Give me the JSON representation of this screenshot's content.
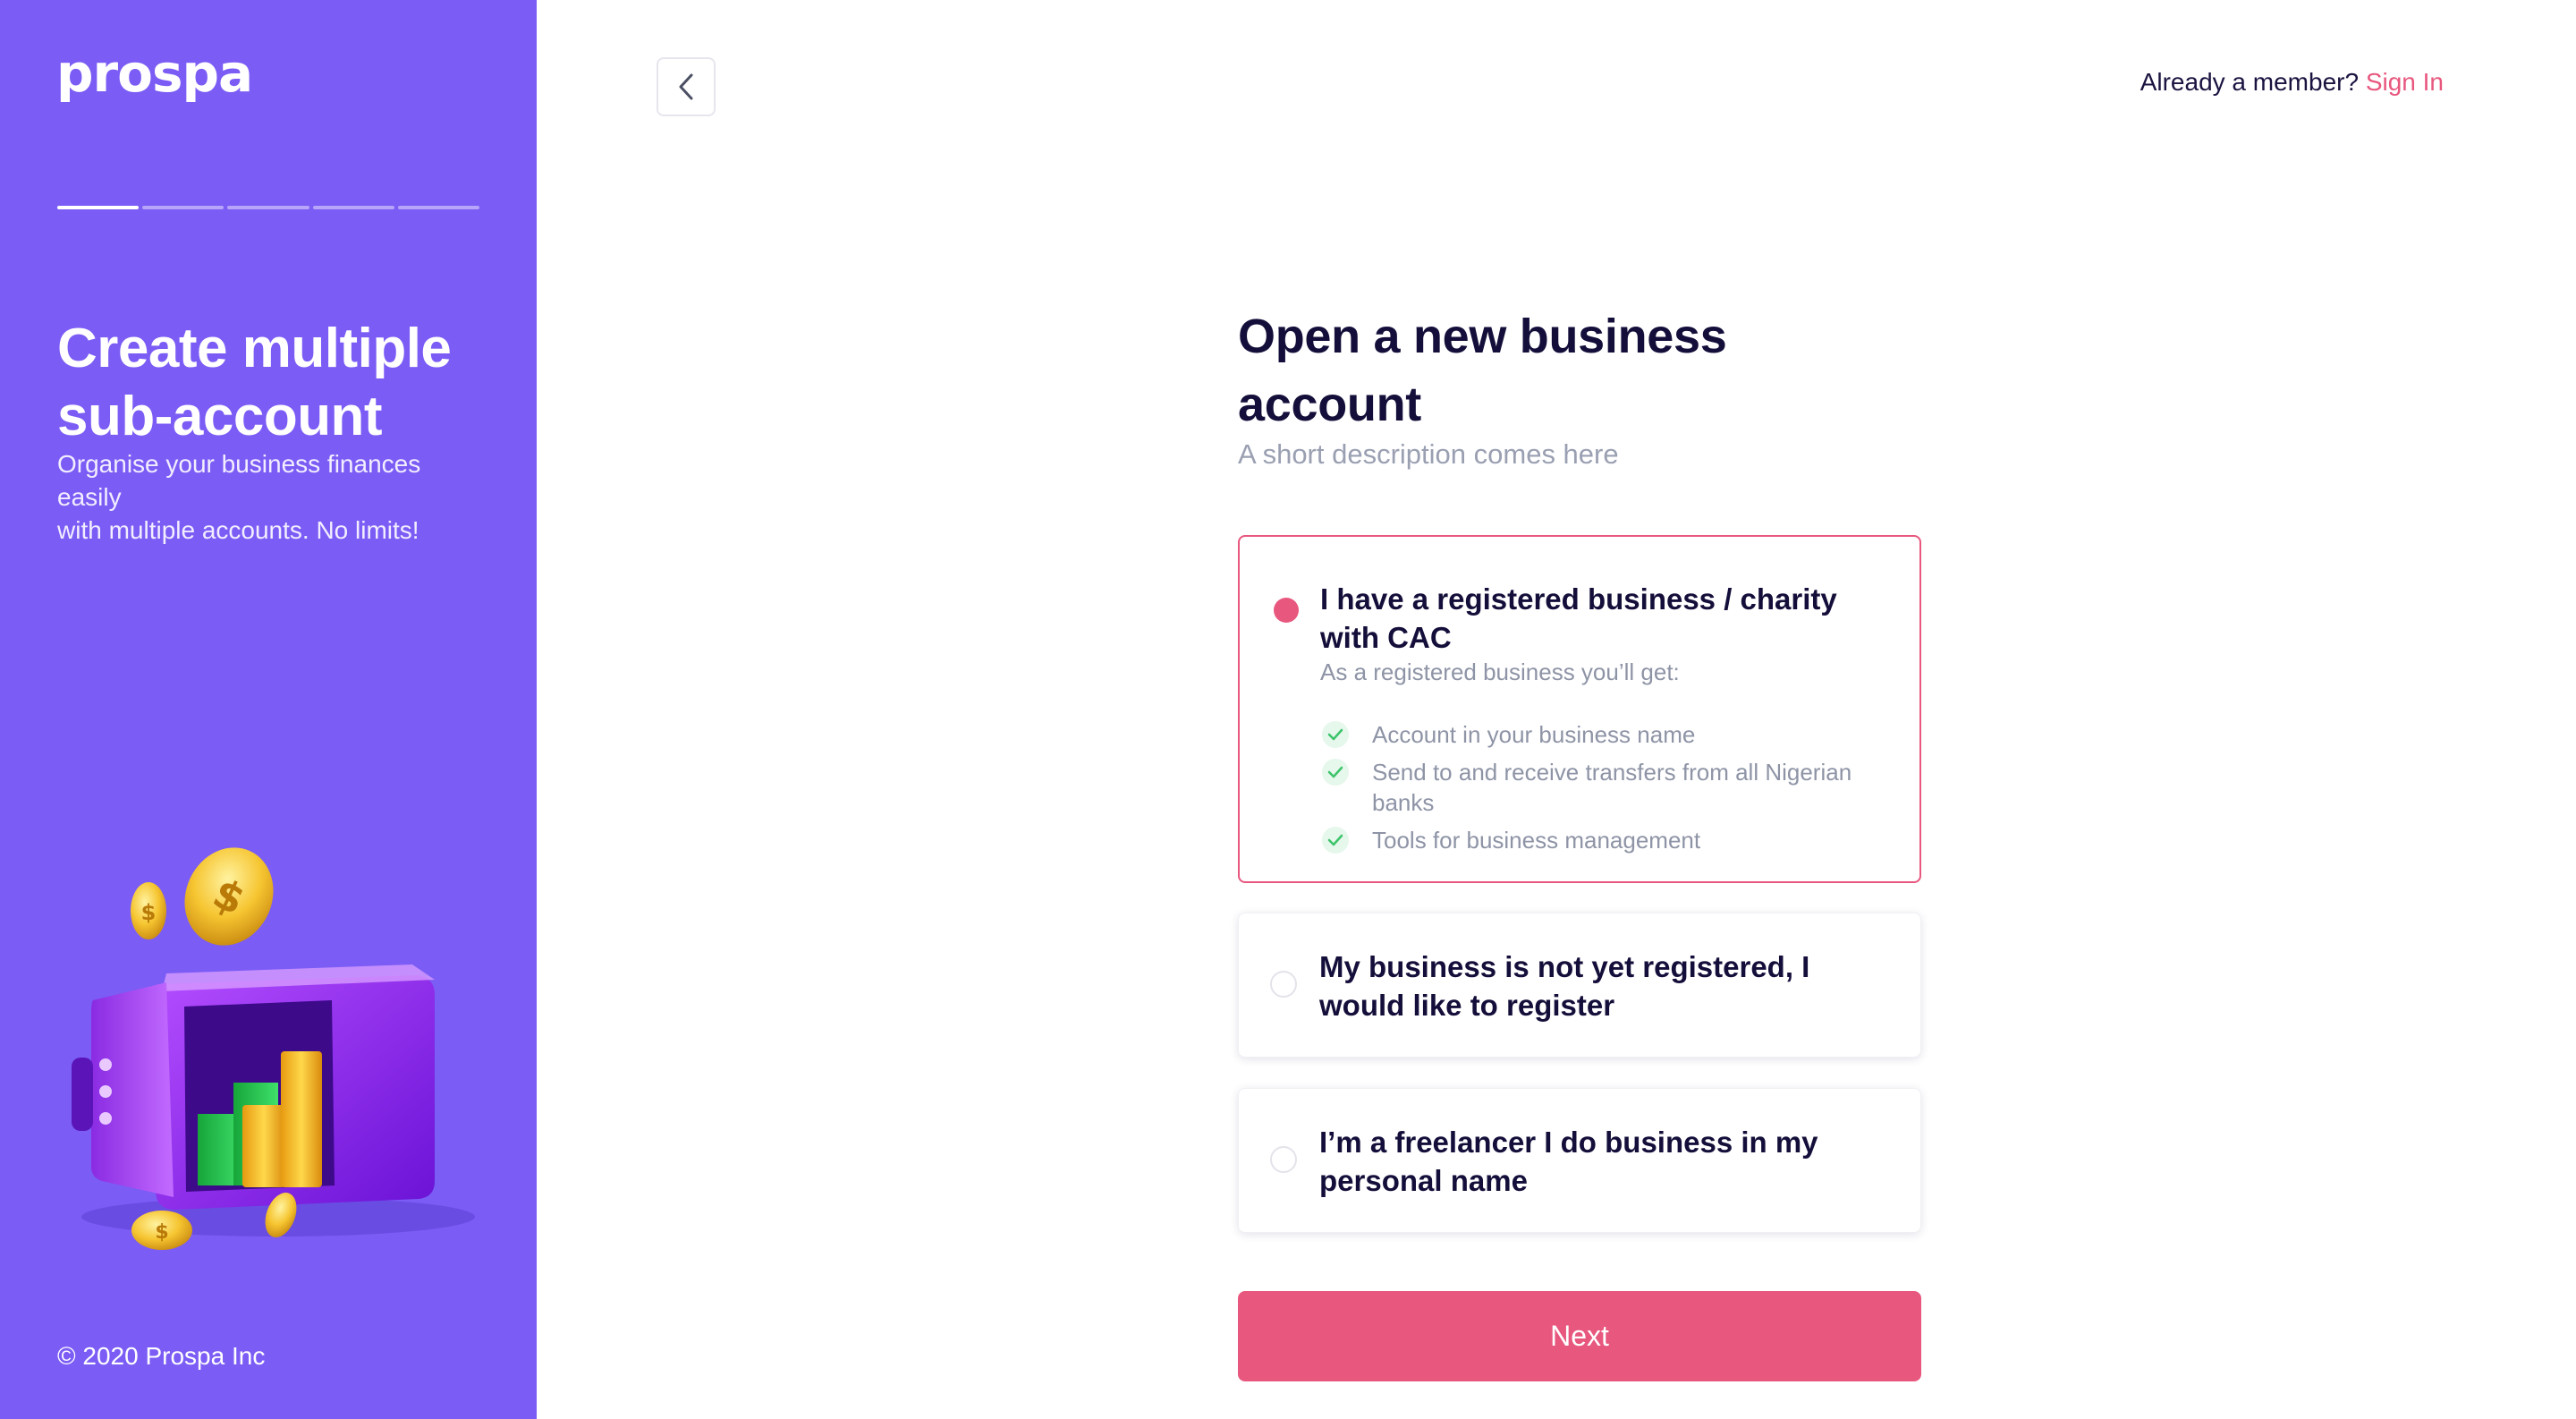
{
  "brand": {
    "logo_text": "prospa"
  },
  "sidebar": {
    "progress": {
      "total_steps": 5,
      "current_step": 1
    },
    "promo_title": "Create multiple sub-account",
    "promo_line1": "Organise your business finances easily",
    "promo_line2": "with multiple accounts. No limits!",
    "copyright": "© 2020 Prospa Inc",
    "illustration": "safe-with-coins-illustration"
  },
  "header": {
    "back_icon": "chevron-left-icon",
    "member_prompt": "Already a member?",
    "sign_in_label": "Sign In"
  },
  "main": {
    "title": "Open a new business account",
    "description": "A short description comes here",
    "options": [
      {
        "title": "I have a registered business / charity with CAC",
        "subtitle": "As a registered business you’ll get:",
        "benefits": [
          "Account in your business name",
          "Send to and receive transfers from all Nigerian banks",
          "Tools for business management"
        ],
        "selected": true
      },
      {
        "title": "My business is not yet registered, I would like to register",
        "selected": false
      },
      {
        "title": "I’m a freelancer I do business in my personal name",
        "selected": false
      }
    ],
    "next_label": "Next"
  },
  "colors": {
    "sidebar_bg": "#7B5CF5",
    "accent": "#E8577E",
    "heading": "#140F3A",
    "muted": "#9AA0B2",
    "check": "#3CC46A"
  }
}
